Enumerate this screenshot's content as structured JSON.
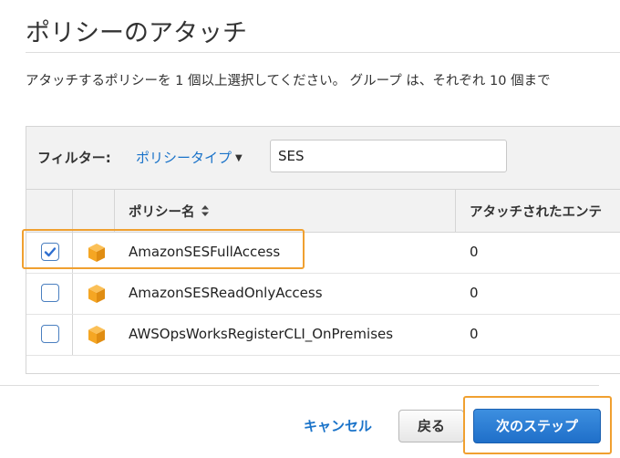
{
  "page": {
    "title": "ポリシーのアタッチ",
    "description": "アタッチするポリシーを 1 個以上選択してください。 グループ は、それぞれ 10 個まで"
  },
  "filter": {
    "label": "フィルター:",
    "policy_type_label": "ポリシータイプ",
    "search_value": "SES"
  },
  "table": {
    "columns": [
      "ポリシー名",
      "アタッチされたエンテ"
    ],
    "rows": [
      {
        "name": "AmazonSESFullAccess",
        "count": "0",
        "checked": true
      },
      {
        "name": "AmazonSESReadOnlyAccess",
        "count": "0",
        "checked": false
      },
      {
        "name": "AWSOpsWorksRegisterCLI_OnPremises",
        "count": "0",
        "checked": false
      }
    ]
  },
  "footer": {
    "cancel_label": "キャンセル",
    "back_label": "戻る",
    "next_label": "次のステップ"
  },
  "colors": {
    "link": "#1a73c9",
    "primary_button": "#2477d0",
    "highlight": "#f0a030",
    "policy_icon": "#f5a623"
  },
  "icons": {
    "policy_icon": "package-icon",
    "checkbox": "checkmark-icon",
    "sort": "sort-icon",
    "dropdown": "caret-down-icon"
  }
}
